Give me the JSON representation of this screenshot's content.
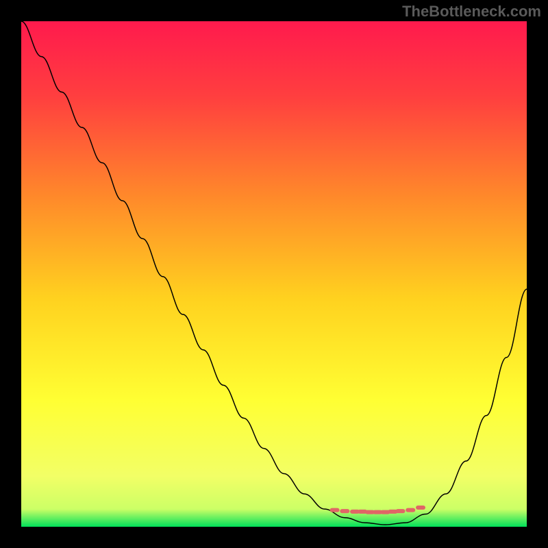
{
  "attribution": "TheBottleneck.com",
  "chart_data": {
    "type": "line",
    "title": "",
    "xlabel": "",
    "ylabel": "",
    "xlim": [
      0,
      100
    ],
    "ylim": [
      0,
      100
    ],
    "background_gradient": {
      "stops": [
        {
          "offset": 0.0,
          "color": "#ff1a4d"
        },
        {
          "offset": 0.15,
          "color": "#ff3f3f"
        },
        {
          "offset": 0.35,
          "color": "#ff8a2a"
        },
        {
          "offset": 0.55,
          "color": "#ffd21f"
        },
        {
          "offset": 0.75,
          "color": "#ffff33"
        },
        {
          "offset": 0.9,
          "color": "#f2ff66"
        },
        {
          "offset": 0.965,
          "color": "#ccff66"
        },
        {
          "offset": 1.0,
          "color": "#00e05a"
        }
      ]
    },
    "series": [
      {
        "name": "bottleneck-curve",
        "x": [
          0,
          4,
          8,
          12,
          16,
          20,
          24,
          28,
          32,
          36,
          40,
          44,
          48,
          52,
          56,
          60,
          64,
          68,
          72,
          76,
          80,
          84,
          88,
          92,
          96,
          100
        ],
        "y_percent_from_top": [
          0,
          7,
          14,
          21,
          28,
          35.5,
          43,
          50.5,
          58,
          65,
          72,
          78.5,
          84.5,
          89.5,
          93.5,
          96.5,
          98.2,
          99.2,
          99.6,
          99.2,
          97.5,
          93.5,
          87,
          78,
          66.5,
          53
        ],
        "color": "#000000"
      },
      {
        "name": "optimal-zone-dots",
        "x": [
          62,
          64,
          66,
          67.5,
          69,
          70.5,
          72,
          73.5,
          75,
          77,
          79
        ],
        "y_percent_from_top": [
          96.7,
          96.9,
          97.0,
          97.0,
          97.1,
          97.1,
          97.1,
          97.0,
          96.9,
          96.7,
          96.2
        ],
        "color": "#e06666",
        "style": "dotted"
      }
    ]
  }
}
